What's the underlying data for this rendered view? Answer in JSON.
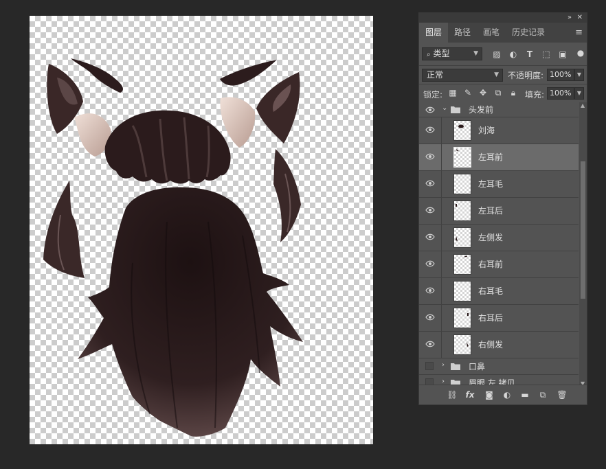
{
  "panel": {
    "tabs": [
      {
        "label": "图层"
      },
      {
        "label": "路径"
      },
      {
        "label": "画笔"
      },
      {
        "label": "历史记录"
      }
    ],
    "filter": {
      "label": "类型"
    },
    "blend_mode": "正常",
    "opacity_label": "不透明度:",
    "opacity_value": "100%",
    "lock_label": "锁定:",
    "fill_label": "填充:",
    "fill_value": "100%",
    "group_open": {
      "name": "头发前"
    },
    "layers": [
      {
        "name": "刘海"
      },
      {
        "name": "左耳前"
      },
      {
        "name": "左耳毛"
      },
      {
        "name": "左耳后"
      },
      {
        "name": "左侧发"
      },
      {
        "name": "右耳前"
      },
      {
        "name": "右耳毛"
      },
      {
        "name": "右耳后"
      },
      {
        "name": "右侧发"
      }
    ],
    "groups_closed": [
      {
        "name": "口鼻"
      },
      {
        "name": "眉眼 左 拷贝"
      }
    ]
  },
  "colors": {
    "hair_dark": "#2a1a1b",
    "hair_mid": "#4a3434",
    "fur": "#dcc4b8"
  }
}
